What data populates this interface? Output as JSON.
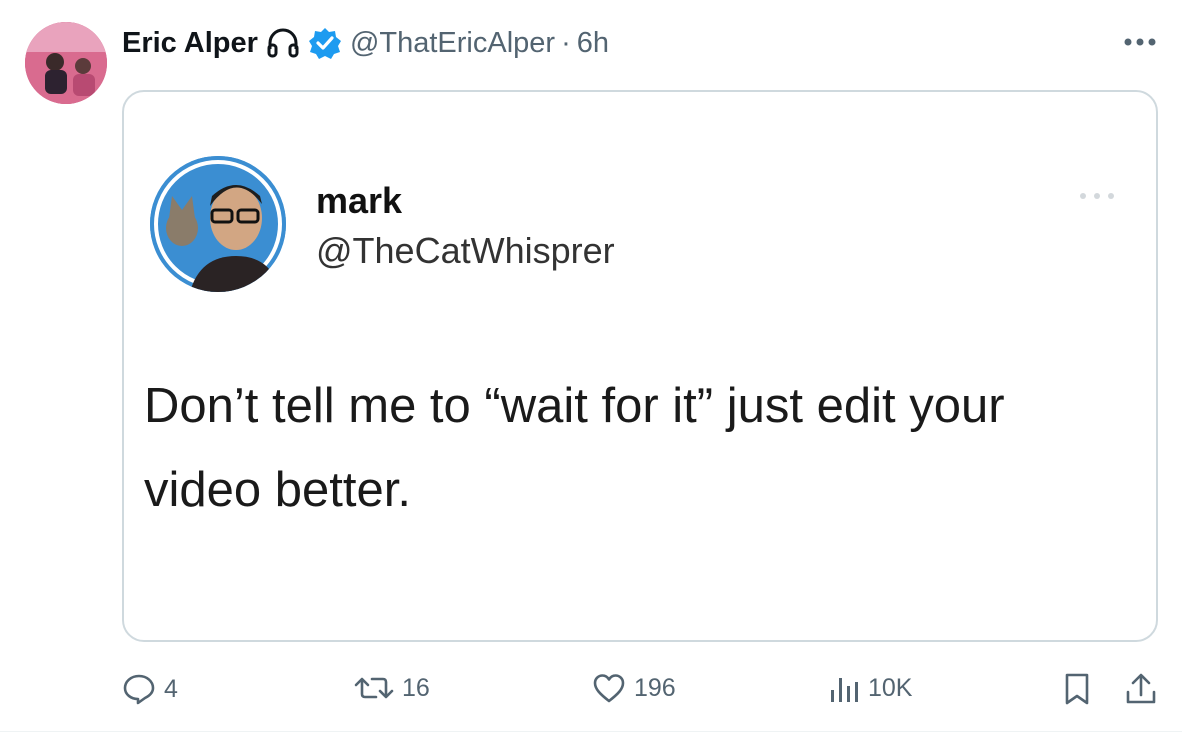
{
  "tweet": {
    "author_name": "Eric Alper",
    "author_handle": "@ThatEricAlper",
    "separator": "·",
    "timestamp": "6h",
    "icons": [
      "headphones-icon",
      "verified-badge-icon",
      "more-icon"
    ]
  },
  "quoted_image": {
    "name": "mark",
    "handle": "@TheCatWhisprer",
    "text": "Don’t tell me to “wait for it” just edit your video better."
  },
  "actions": {
    "replies": "4",
    "retweets": "16",
    "likes": "196",
    "views": "10K"
  },
  "colors": {
    "text_primary": "#0f1419",
    "text_secondary": "#536471",
    "verified": "#1d9bf0",
    "border": "#cfd9de"
  }
}
